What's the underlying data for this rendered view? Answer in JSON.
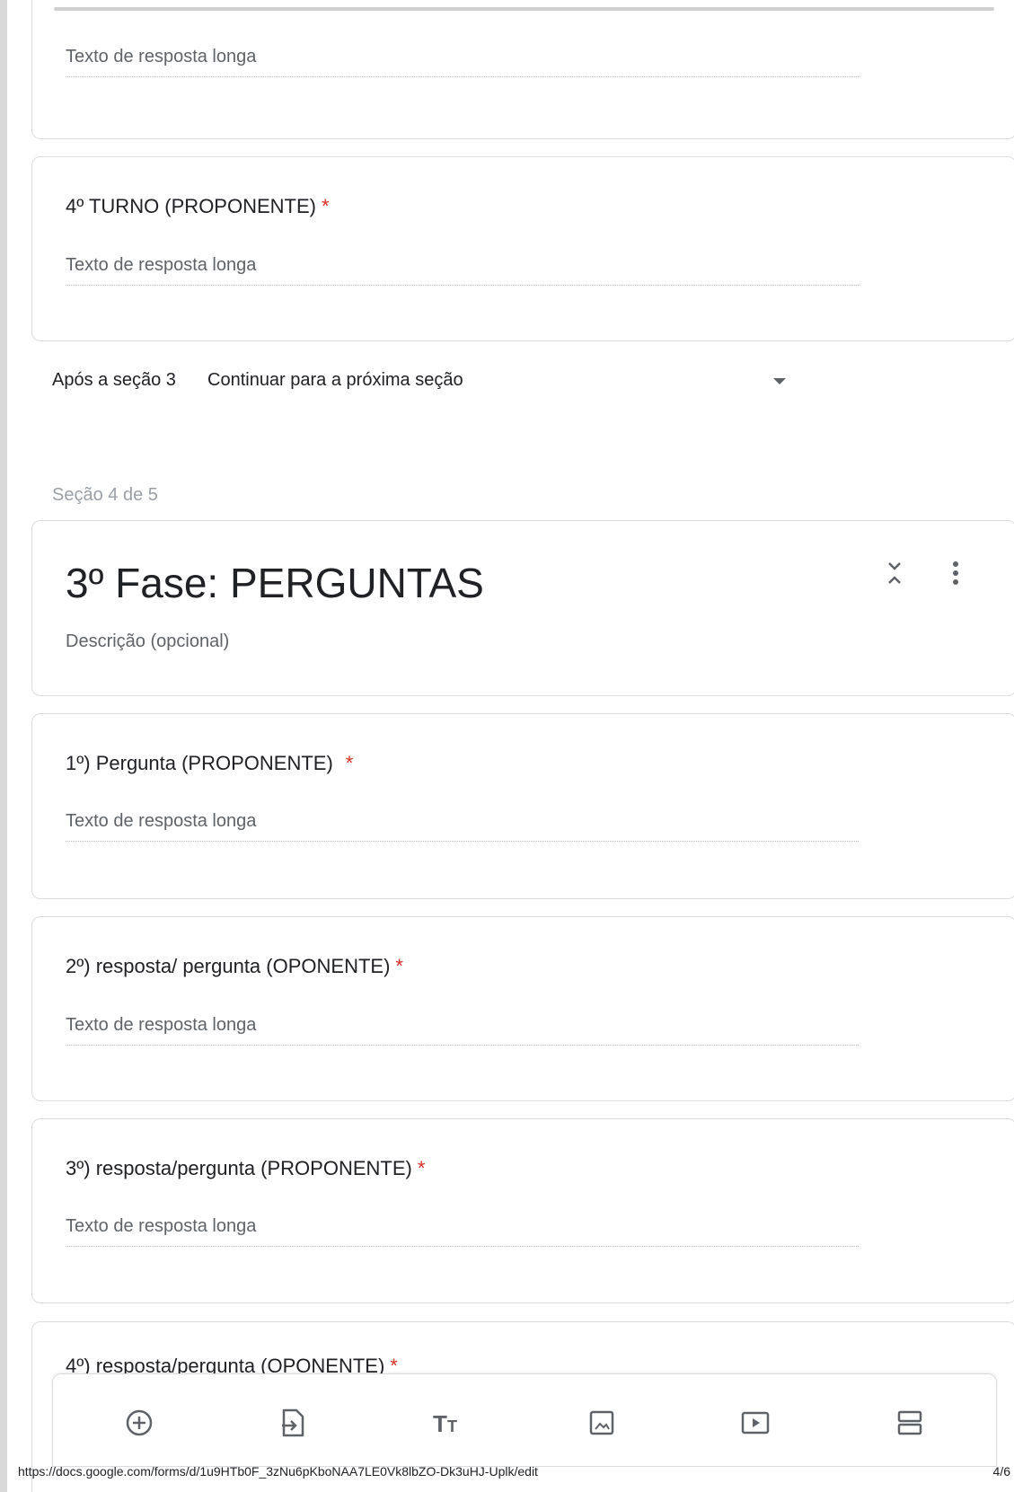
{
  "cards": [
    {
      "answer_placeholder": "Texto de resposta longa"
    },
    {
      "title": "4º TURNO (PROPONENTE)",
      "required": "*",
      "answer_placeholder": "Texto de resposta longa"
    }
  ],
  "after_section": {
    "label": "Após a seção 3",
    "value": "Continuar para a próxima seção"
  },
  "section_label": "Seção 4 de 5",
  "section": {
    "title": "3º Fase: PERGUNTAS",
    "description": "Descrição (opcional)"
  },
  "questions": [
    {
      "title": "1º) Pergunta (PROPONENTE)",
      "required": "*",
      "answer_placeholder": "Texto de resposta longa"
    },
    {
      "title": "2º) resposta/ pergunta (OPONENTE)",
      "required": "*",
      "answer_placeholder": "Texto de resposta longa"
    },
    {
      "title": "3º) resposta/pergunta (PROPONENTE)",
      "required": "*",
      "answer_placeholder": "Texto de resposta longa"
    },
    {
      "title": "4º) resposta/pergunta (OPONENTE)",
      "required": "*"
    }
  ],
  "toolbar": {
    "icons": [
      "add-question-icon",
      "import-questions-icon",
      "add-title-icon",
      "add-image-icon",
      "add-video-icon",
      "add-section-icon"
    ]
  },
  "footer": {
    "url": "https://docs.google.com/forms/d/1u9HTb0F_3zNu6pKboNAA7LE0Vk8lbZO-Dk3uHJ-Uplk/edit",
    "page": "4/6"
  },
  "colors": {
    "required": "#d93025",
    "border": "#dadce0",
    "muted": "#5f6368"
  }
}
